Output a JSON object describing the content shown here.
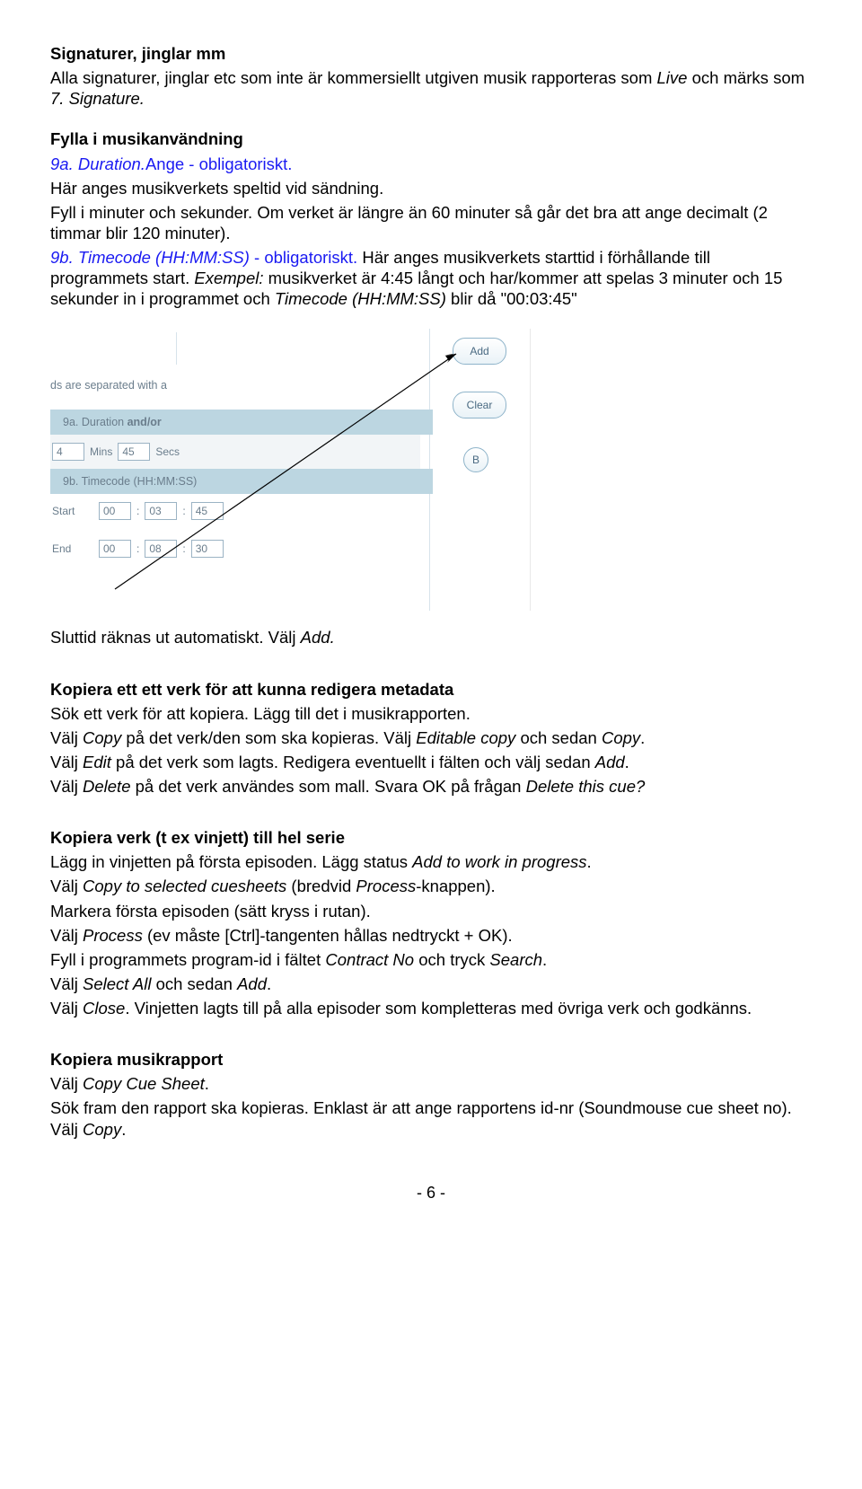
{
  "section1": {
    "heading": "Signaturer, jinglar mm",
    "p1a": "Alla signaturer, jinglar etc som inte är kommersiellt utgiven musik rapporteras som ",
    "p1b": "Live",
    "p1c": " och märks som ",
    "p1d": "7. Signature.",
    "h2": "Fylla i musikanvändning",
    "l9a_code": "9a. Duration.",
    "l9a_rest": "Ange - obligatoriskt.",
    "l9a_p": "Här anges musikverkets speltid vid sändning.",
    "l9a_p2": "Fyll i minuter och sekunder. Om verket är längre än 60 minuter så går det bra att ange decimalt (2 timmar blir 120 minuter).",
    "l9b_code": "9b. Timecode (HH:MM:SS)",
    "l9b_rest": " - obligatoriskt.",
    "l9b_p1": " Här anges musikverkets starttid i förhållande till programmets start. ",
    "l9b_ex_lead": "Exempel:",
    "l9b_ex": " musikverket är 4:45 långt och har/kommer att spelas 3 minuter och 15 sekunder in i programmet och ",
    "l9b_tc": "Timecode (HH:MM:SS)",
    "l9b_tail": " blir då \"00:03:45\""
  },
  "shot": {
    "toptxt": "ds are separated with a",
    "bar9a_a": "9a. Duration ",
    "bar9a_b": "and/or",
    "mins_val": "4",
    "mins_lbl": "Mins",
    "secs_val": "45",
    "secs_lbl": "Secs",
    "bar9b": "9b. Timecode (HH:MM:SS)",
    "start_lbl": "Start",
    "end_lbl": "End",
    "s_hh": "00",
    "s_mm": "03",
    "s_ss": "45",
    "e_hh": "00",
    "e_mm": "08",
    "e_ss": "30",
    "btn_add": "Add",
    "btn_clear": "Clear",
    "btn_b": "B"
  },
  "after_shot": {
    "p1a": "Sluttid räknas ut automatiskt. Välj ",
    "p1b": "Add."
  },
  "copy_one": {
    "h": "Kopiera ett ett verk för att kunna redigera metadata",
    "l1": "Sök ett verk för att kopiera. Lägg till det i musikrapporten.",
    "l2a": "Välj ",
    "l2b": "Copy",
    "l2c": " på det verk/den som ska kopieras. Välj ",
    "l2d": "Editable copy",
    "l2e": " och sedan ",
    "l2f": "Copy",
    "l2g": ".",
    "l3a": "Välj ",
    "l3b": "Edit",
    "l3c": " på det verk som lagts. Redigera eventuellt i fälten och välj sedan ",
    "l3d": "Add",
    "l3e": ".",
    "l4a": "Välj ",
    "l4b": "Delete",
    "l4c": " på det verk användes som mall. Svara OK på frågan ",
    "l4d": "Delete this cue?"
  },
  "copy_series": {
    "h": "Kopiera verk (t ex vinjett) till hel serie",
    "l1a": "Lägg in vinjetten på första episoden. Lägg status ",
    "l1b": "Add to work in progress",
    "l1c": ".",
    "l2a": "Välj ",
    "l2b": "Copy to selected cuesheets",
    "l2c": " (bredvid ",
    "l2d": "Process",
    "l2e": "-knappen).",
    "l3": "Markera första episoden (sätt kryss i rutan).",
    "l4a": "Välj ",
    "l4b": "Process",
    "l4c": " (ev måste [Ctrl]-tangenten hållas nedtryckt + OK).",
    "l5a": "Fyll i programmets program-id i fältet ",
    "l5b": "Contract No",
    "l5c": " och tryck ",
    "l5d": "Search",
    "l5e": ".",
    "l6a": "Välj ",
    "l6b": "Select All",
    "l6c": " och sedan ",
    "l6d": "Add",
    "l6e": ".",
    "l7a": "Välj ",
    "l7b": "Close",
    "l7c": ". Vinjetten lagts till på alla episoder som kompletteras med övriga verk och godkänns."
  },
  "copy_report": {
    "h": "Kopiera musikrapport",
    "l1a": "Välj ",
    "l1b": "Copy Cue Sheet",
    "l1c": ".",
    "l2a": "Sök fram den rapport ska kopieras. Enklast är att ange rapportens id-nr (Soundmouse cue sheet no). Välj ",
    "l2b": "Copy",
    "l2c": "."
  },
  "page_no": "- 6 -"
}
